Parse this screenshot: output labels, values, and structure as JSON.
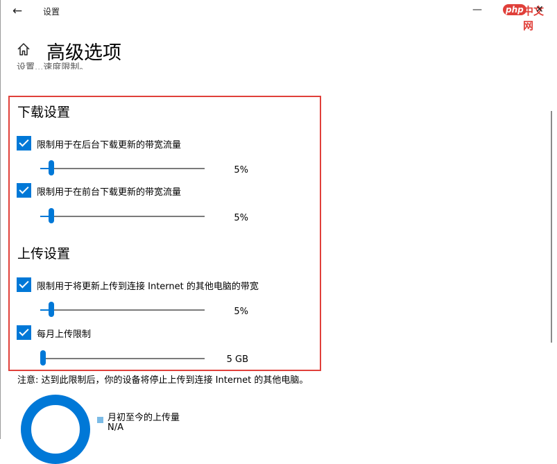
{
  "window": {
    "title": "设置",
    "back_icon": "←",
    "minimize_icon": "—",
    "close_icon": "✕"
  },
  "watermark": {
    "logo": "php",
    "text": "中文网"
  },
  "header": {
    "title": "高级选项",
    "clipped_text": "设置...速度限制。"
  },
  "download": {
    "title": "下载设置",
    "background": {
      "checked": true,
      "label": "限制用于在后台下载更新的带宽流量",
      "value_text": "5%",
      "percent": 5
    },
    "foreground": {
      "checked": true,
      "label": "限制用于在前台下载更新的带宽流量",
      "value_text": "5%",
      "percent": 5
    }
  },
  "upload": {
    "title": "上传设置",
    "bandwidth": {
      "checked": true,
      "label": "限制用于将更新上传到连接 Internet 的其他电脑的带宽",
      "value_text": "5%",
      "percent": 5
    },
    "monthly": {
      "checked": true,
      "label": "每月上传限制",
      "value_text": "5 GB",
      "fraction": 0.0
    }
  },
  "note": "注意: 达到此限制后，你的设备将停止上传到连接 Internet 的其他电脑。",
  "stats": {
    "legend_label": "月初至今的上传量",
    "legend_value": "N/A",
    "accent_color": "#0078d7",
    "swatch_color": "#7bbbe6"
  },
  "colors": {
    "accent": "#0078d7",
    "highlight": "#e0403a"
  }
}
